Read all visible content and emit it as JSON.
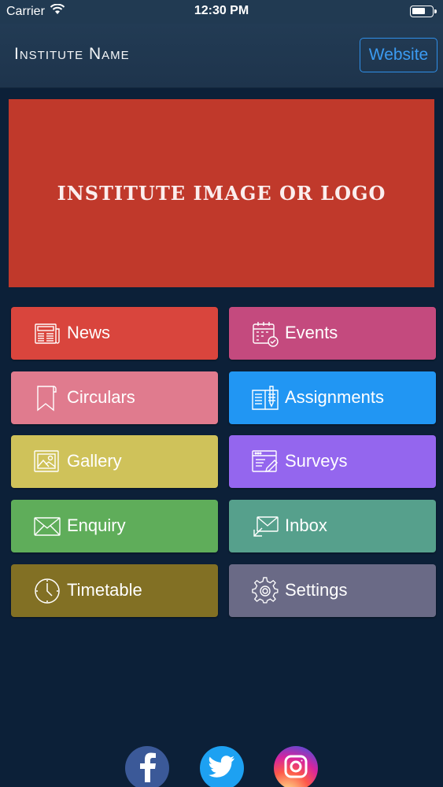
{
  "status": {
    "carrier": "Carrier",
    "time": "12:30 PM"
  },
  "header": {
    "title": "Institute Name",
    "website_label": "Website"
  },
  "banner": {
    "text": "INSTITUTE IMAGE OR LOGO"
  },
  "tiles": [
    {
      "label": "News",
      "color": "#d9453d",
      "icon": "newspaper-icon"
    },
    {
      "label": "Events",
      "color": "#c44a7e",
      "icon": "calendar-icon"
    },
    {
      "label": "Circulars",
      "color": "#e07b8e",
      "icon": "bookmark-icon"
    },
    {
      "label": "Assignments",
      "color": "#2196f3",
      "icon": "book-pen-icon"
    },
    {
      "label": "Gallery",
      "color": "#cfc25a",
      "icon": "image-icon"
    },
    {
      "label": "Surveys",
      "color": "#9466ee",
      "icon": "form-pen-icon"
    },
    {
      "label": "Enquiry",
      "color": "#5fad5a",
      "icon": "envelope-icon"
    },
    {
      "label": "Inbox",
      "color": "#56a08c",
      "icon": "inbox-mail-icon"
    },
    {
      "label": "Timetable",
      "color": "#827024",
      "icon": "clock-icon"
    },
    {
      "label": "Settings",
      "color": "#6a6a86",
      "icon": "gear-icon"
    }
  ],
  "social": [
    {
      "name": "facebook-icon",
      "color": "#3b5998"
    },
    {
      "name": "twitter-icon",
      "color": "#1da1f2"
    },
    {
      "name": "instagram-icon",
      "color": "#d6249f"
    }
  ]
}
